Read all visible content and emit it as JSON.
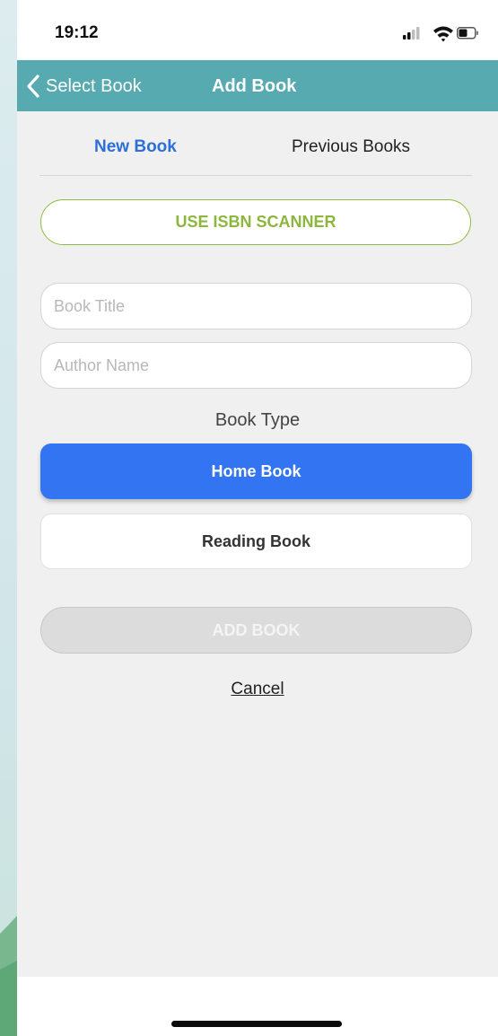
{
  "status_bar": {
    "time": "19:12",
    "icons": [
      "signal-icon",
      "wifi-icon",
      "battery-icon"
    ]
  },
  "nav": {
    "back_label": "Select Book",
    "title": "Add Book"
  },
  "tabs": [
    {
      "label": "New Book",
      "active": true
    },
    {
      "label": "Previous Books",
      "active": false
    }
  ],
  "scanner_button": "USE ISBN SCANNER",
  "form": {
    "book_title": {
      "value": "",
      "placeholder": "Book Title"
    },
    "author_name": {
      "value": "",
      "placeholder": "Author Name"
    }
  },
  "book_type": {
    "label": "Book Type",
    "options": [
      {
        "label": "Home Book",
        "selected": true
      },
      {
        "label": "Reading Book",
        "selected": false
      }
    ]
  },
  "add_button": "ADD BOOK",
  "cancel": "Cancel",
  "colors": {
    "nav_bar": "#56aab0",
    "accent_blue": "#3374f2",
    "tab_active": "#2e6fd6",
    "scanner_green": "#8cb63c",
    "disabled_gray": "#dcdcdc"
  }
}
